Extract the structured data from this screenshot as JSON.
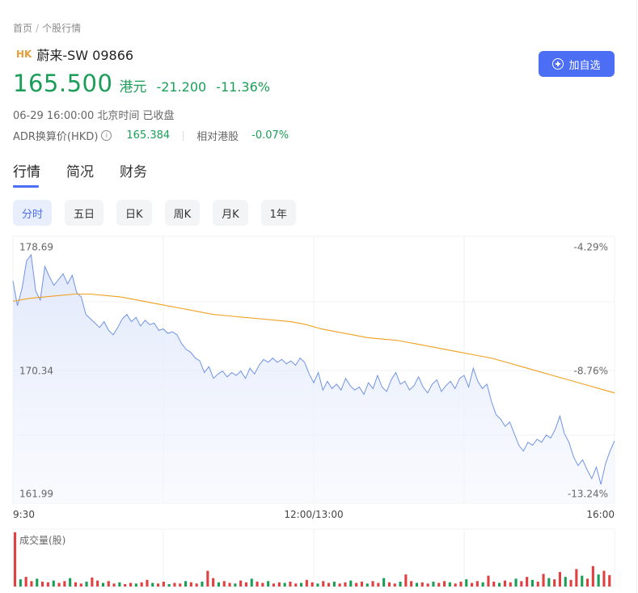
{
  "breadcrumb": {
    "home": "首页",
    "sep": "/",
    "current": "个股行情"
  },
  "stock": {
    "market": "HK",
    "name": "蔚来-SW 09866"
  },
  "add_button": "加自选",
  "quote": {
    "price": "165.500",
    "currency": "港元",
    "change": "-21.200",
    "change_pct": "-11.36%"
  },
  "status_time": "06-29 16:00:00 北京时间 已收盘",
  "adr": {
    "label": "ADR换算价(HKD)",
    "info_glyph": "i",
    "value": "165.384",
    "rel_label": "相对港股",
    "rel_value": "-0.07%"
  },
  "tabs": [
    "行情",
    "简况",
    "财务"
  ],
  "periods": [
    "分时",
    "五日",
    "日K",
    "周K",
    "月K",
    "1年"
  ],
  "colors": {
    "accent": "#4c6ef5",
    "down": "#1a9e57",
    "price_line": "#6f93e6",
    "avg_line": "#f0a020",
    "vol_up": "#e04040",
    "vol_down": "#1a9e57"
  },
  "chart_data": {
    "type": "line",
    "y_left_labels": [
      "178.69",
      "170.34",
      "161.99"
    ],
    "y_right_labels": [
      "-4.29%",
      "-8.76%",
      "-13.24%"
    ],
    "ylim": [
      161.99,
      178.69
    ],
    "x_labels": [
      "9:30",
      "12:00/13:00",
      "16:00"
    ],
    "volume_label": "成交量(股)",
    "series": [
      {
        "values": [
          176.5,
          174.8,
          176.0,
          177.9,
          178.3,
          175.8,
          175.2,
          177.5,
          176.8,
          176.2,
          176.6,
          177.0,
          176.3,
          176.9,
          175.7,
          175.4,
          174.2,
          173.9,
          173.6,
          173.3,
          173.7,
          173.1,
          172.8,
          173.3,
          173.9,
          174.2,
          173.7,
          174.0,
          173.4,
          173.8,
          173.5,
          173.6,
          173.1,
          173.2,
          172.9,
          173.0,
          172.8,
          172.2,
          171.8,
          171.6,
          171.2,
          171.0,
          170.2,
          170.6,
          169.8,
          170.1,
          170.3,
          169.9,
          170.2,
          170.0,
          170.3,
          169.8,
          170.5,
          170.1,
          170.7,
          171.1,
          170.9,
          171.2,
          170.9,
          171.1,
          170.8,
          171.0,
          170.7,
          171.2,
          170.9,
          170.1,
          169.5,
          170.2,
          169.0,
          169.6,
          169.1,
          169.4,
          169.0,
          169.8,
          169.3,
          169.0,
          169.2,
          168.7,
          169.5,
          169.1,
          170.0,
          169.2,
          168.9,
          169.7,
          170.2,
          169.4,
          169.6,
          169.0,
          169.3,
          169.9,
          169.2,
          168.8,
          169.4,
          169.7,
          168.9,
          169.3,
          169.6,
          169.1,
          169.8,
          170.0,
          169.2,
          170.5,
          169.6,
          169.1,
          169.4,
          168.2,
          167.3,
          167.0,
          166.5,
          166.8,
          166.0,
          165.2,
          164.8,
          165.4,
          165.2,
          165.6,
          165.4,
          165.9,
          165.7,
          166.3,
          167.2,
          166.0,
          165.4,
          164.4,
          163.8,
          164.2,
          163.5,
          162.9,
          163.7,
          162.5,
          163.9,
          164.8,
          165.5
        ]
      },
      {
        "values": [
          175.1,
          175.3,
          175.4,
          175.5,
          175.6,
          175.6,
          175.5,
          175.4,
          175.2,
          175.0,
          174.8,
          174.6,
          174.4,
          174.2,
          174.1,
          174.0,
          173.9,
          173.8,
          173.7,
          173.5,
          173.2,
          173.0,
          172.8,
          172.6,
          172.5,
          172.4,
          172.2,
          172.0,
          171.8,
          171.6,
          171.4,
          171.2,
          170.9,
          170.6,
          170.3,
          170.0,
          169.7,
          169.4,
          169.1,
          168.8
        ]
      }
    ],
    "volume_values": [
      9,
      1.2,
      1.6,
      0.9,
      1.3,
      0.8,
      0.7,
      1.0,
      0.6,
      0.9,
      1.4,
      0.7,
      0.5,
      0.8,
      1.5,
      1.0,
      0.6,
      0.9,
      0.5,
      0.7,
      0.4,
      0.6,
      0.5,
      0.7,
      1.1,
      0.6,
      0.5,
      0.8,
      0.4,
      0.6,
      0.5,
      0.9,
      0.7,
      0.5,
      0.8,
      2.6,
      1.4,
      0.7,
      0.9,
      0.6,
      0.5,
      1.0,
      0.7,
      1.3,
      0.8,
      0.6,
      0.9,
      0.5,
      0.7,
      0.6,
      0.8,
      0.5,
      0.6,
      1.1,
      0.7,
      0.5,
      0.9,
      0.6,
      0.8,
      0.5,
      0.7,
      1.0,
      0.6,
      0.8,
      0.5,
      0.9,
      0.6,
      1.4,
      0.7,
      0.5,
      0.8,
      2.0,
      0.9,
      0.6,
      0.7,
      0.5,
      0.8,
      0.6,
      0.9,
      0.7,
      0.5,
      0.8,
      1.2,
      0.6,
      0.9,
      0.7,
      1.8,
      0.8,
      0.6,
      1.0,
      0.7,
      1.3,
      0.9,
      1.6,
      1.1,
      0.8,
      2.1,
      1.4,
      1.2,
      2.4,
      1.6,
      1.1,
      2.9,
      1.8,
      1.3,
      3.4,
      2.0,
      2.6,
      1.9
    ]
  }
}
